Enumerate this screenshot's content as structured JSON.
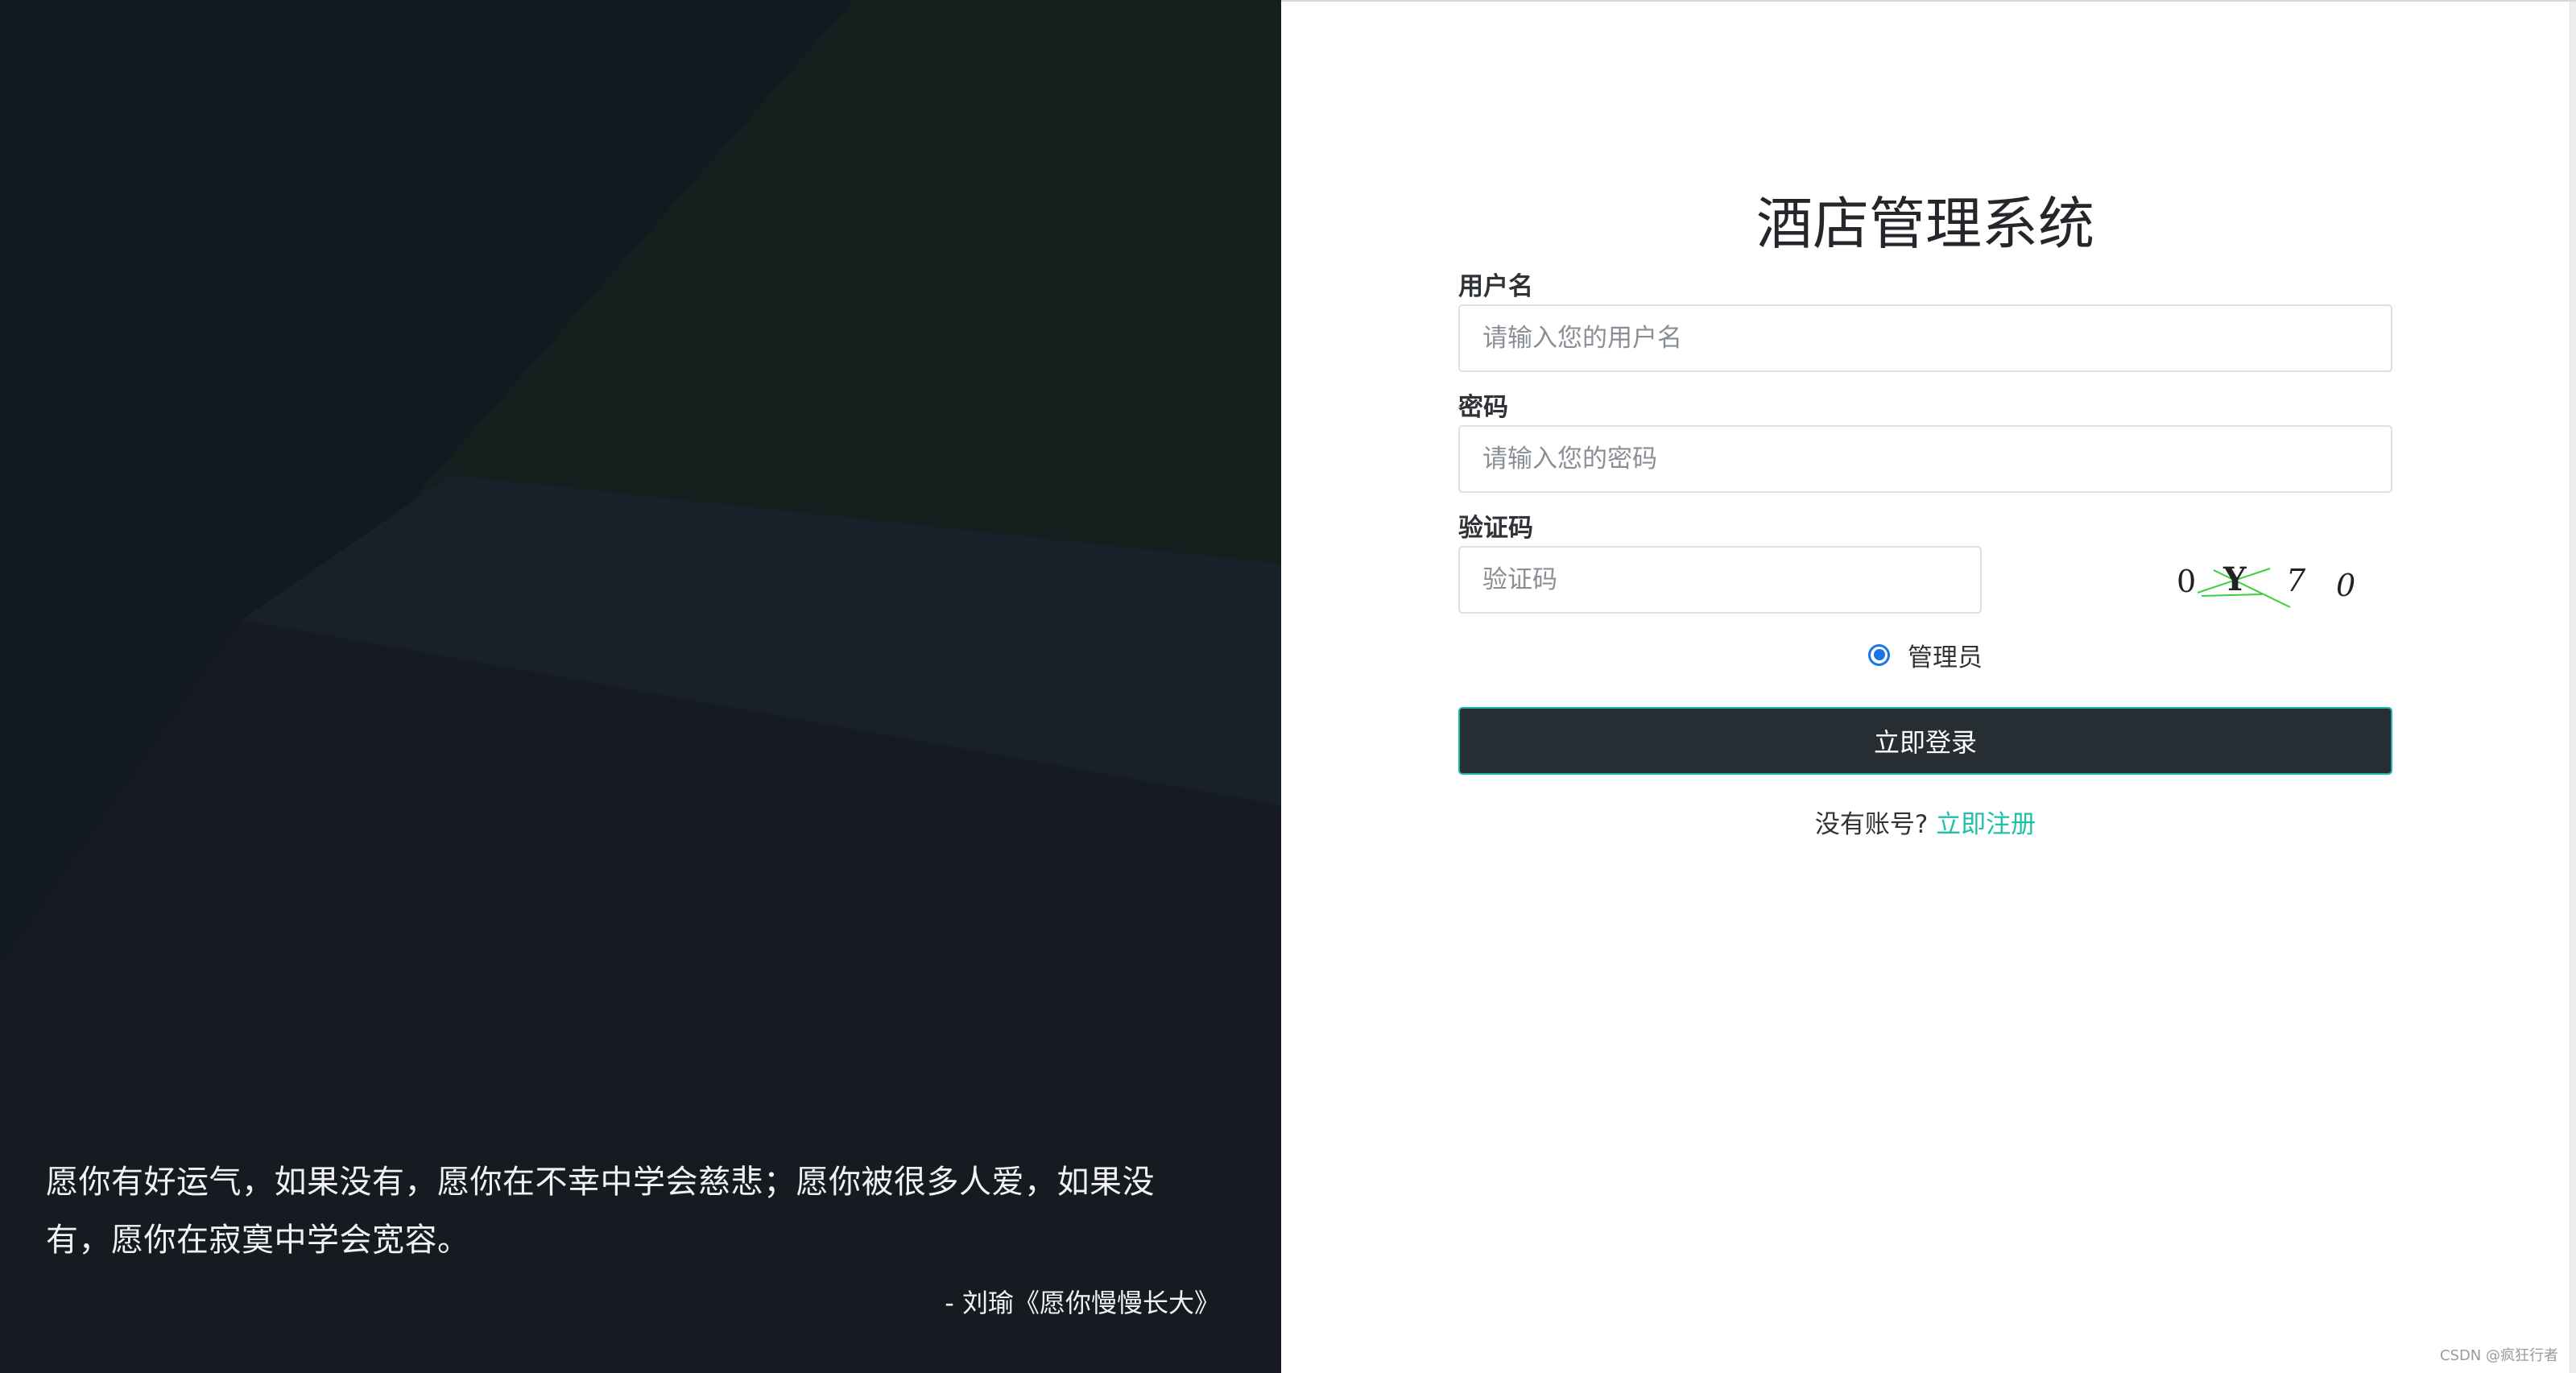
{
  "quote": {
    "line1": "愿你有好运气，如果没有，愿你在不幸中学会慈悲；愿你被很多人爱，如果没",
    "line2": "有，愿你在寂寞中学会宽容。",
    "source": "- 刘瑜《愿你慢慢长大》"
  },
  "login": {
    "title": "酒店管理系统",
    "username_label": "用户名",
    "username_placeholder": "请输入您的用户名",
    "password_label": "密码",
    "password_placeholder": "请输入您的密码",
    "captcha_label": "验证码",
    "captcha_placeholder": "验证码",
    "captcha_code": "0Y70",
    "role_label": "管理员",
    "role_selected": true,
    "submit_label": "立即登录",
    "register_prompt": "没有账号?",
    "register_link": "立即注册"
  },
  "watermark": "CSDN @疯狂行者",
  "colors": {
    "left_bg": "#151b21",
    "button_bg": "#262d33",
    "button_border": "#1fb5a8",
    "link": "#1fbfa9",
    "radio": "#1a73e8"
  }
}
